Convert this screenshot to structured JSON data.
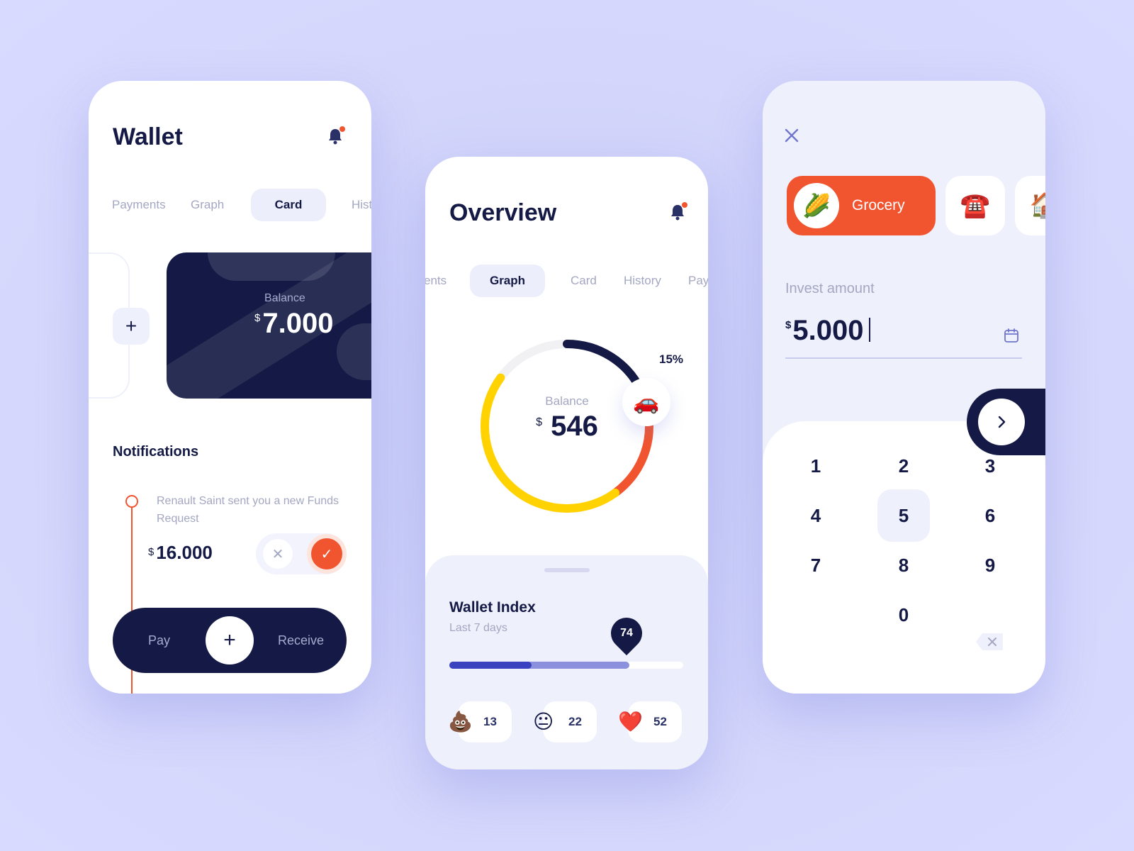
{
  "wallet": {
    "title": "Wallet",
    "tabs": [
      "Payments",
      "Graph",
      "Card",
      "Hist"
    ],
    "card": {
      "label": "Balance",
      "currency": "$",
      "amount": "7.000"
    },
    "add_card": "+",
    "notifications_title": "Notifications",
    "notification": {
      "text": "Renault Saint sent you a new Funds Request",
      "currency": "$",
      "amount": "16.000",
      "decline": "✕",
      "accept": "✓"
    },
    "paybar": {
      "pay": "Pay",
      "receive": "Receive",
      "plus": "+"
    }
  },
  "overview": {
    "title": "Overview",
    "tabs": [
      "ents",
      "Graph",
      "Card",
      "History",
      "Pay"
    ],
    "balance": {
      "label": "Balance",
      "currency": "$",
      "amount": "546"
    },
    "percent": "15%",
    "car_emoji": "🚗",
    "wallet_index": {
      "title": "Wallet Index",
      "subtitle": "Last 7 days",
      "value": "74",
      "primary_progress": 0.35,
      "secondary_progress": 0.77
    },
    "reactions": [
      {
        "emoji": "💩",
        "count": "13"
      },
      {
        "emoji": "😐",
        "count": "22"
      },
      {
        "emoji": "❤️",
        "count": "52"
      }
    ],
    "donut_segments": [
      {
        "color": "#141a45",
        "fraction": 0.18
      },
      {
        "color": "#f1552f",
        "fraction": 0.22
      },
      {
        "color": "#ffd200",
        "fraction": 0.45
      },
      {
        "color": "#f1f1f4",
        "fraction": 0.15
      }
    ]
  },
  "invest": {
    "categories": [
      {
        "emoji": "🌽",
        "label": "Grocery"
      },
      {
        "emoji": "☎️",
        "label": ""
      },
      {
        "emoji": "🏠",
        "label": ""
      }
    ],
    "amount_label": "Invest amount",
    "currency": "$",
    "amount": "5.000",
    "keys": [
      "1",
      "2",
      "3",
      "4",
      "5",
      "6",
      "7",
      "8",
      "9",
      "0"
    ],
    "active_key": "5"
  },
  "colors": {
    "navy": "#141a45",
    "accent": "#f1552f",
    "yellow": "#ffd200",
    "muted": "#a3a7c2",
    "lavender": "#eef0fb"
  }
}
